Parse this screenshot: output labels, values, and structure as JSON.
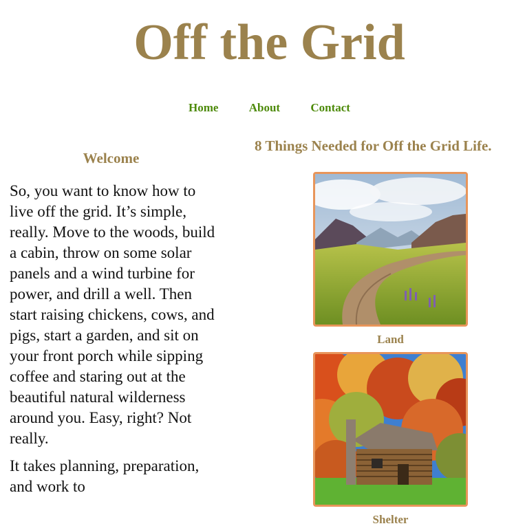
{
  "site": {
    "title": "Off the Grid"
  },
  "nav": {
    "items": [
      "Home",
      "About",
      "Contact"
    ]
  },
  "welcome": {
    "heading": "Welcome",
    "paragraphs": [
      "So, you want to know how to live off the grid. It’s simple, really. Move to the woods, build a cabin, throw on some solar panels and a wind turbine for power, and drill a well. Then start raising chickens, cows, and pigs, start a garden, and sit on your front porch while sipping coffee and staring out at the beautiful natural wilderness around you. Easy, right? Not really.",
      "It takes planning, preparation, and work to"
    ]
  },
  "things": {
    "heading": "8 Things Needed for Off the Grid Life.",
    "cards": [
      {
        "caption": "Land",
        "image": "mountain-valley-path-photo"
      },
      {
        "caption": "Shelter",
        "image": "log-cabin-autumn-forest-photo"
      }
    ]
  },
  "colors": {
    "title": "#9b824d",
    "nav_link": "#4d8a0a",
    "card_border": "#e8955a",
    "text": "#111111"
  }
}
